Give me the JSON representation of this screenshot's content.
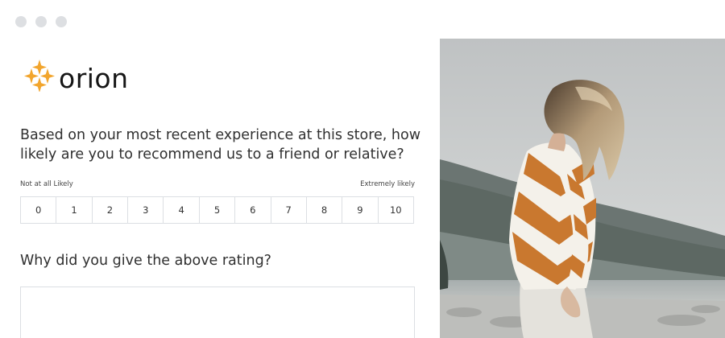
{
  "window": {
    "controls": [
      "window-dot",
      "window-dot",
      "window-dot"
    ]
  },
  "brand": {
    "name": "orion",
    "logo_icon": "sparkle-stars-icon",
    "accent_color": "#f2a52d"
  },
  "survey": {
    "question_1": {
      "line_1": "Based on your most recent experience at this store, how",
      "line_2": "likely are you to recommend us to a friend or relative?"
    },
    "scale": {
      "low_label": "Not at all Likely",
      "high_label": "Extremely likely",
      "options": [
        "0",
        "1",
        "2",
        "3",
        "4",
        "5",
        "6",
        "7",
        "8",
        "9",
        "10"
      ]
    },
    "question_2": "Why did you give the above rating?",
    "comment_value": ""
  },
  "hero_image": {
    "subject": "woman in orange and white chevron sweater by a lake"
  }
}
